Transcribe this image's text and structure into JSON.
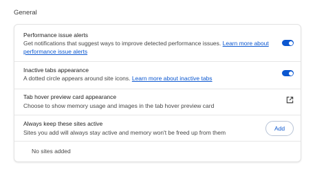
{
  "section": {
    "title": "General"
  },
  "performance_alerts": {
    "title": "Performance issue alerts",
    "desc_prefix": "Get notifications that suggest ways to improve detected performance issues. ",
    "link": "Learn more about performance issue alerts",
    "toggle_on": true
  },
  "inactive_tabs": {
    "title": "Inactive tabs appearance",
    "desc_prefix": "A dotted circle appears around site icons. ",
    "link": "Learn more about inactive tabs",
    "toggle_on": true
  },
  "hover_preview": {
    "title": "Tab hover preview card appearance",
    "desc": "Choose to show memory usage and images in the tab hover preview card",
    "icon": "open-in-new-icon"
  },
  "keep_active": {
    "title": "Always keep these sites active",
    "desc": "Sites you add will always stay active and memory won't be freed up from them",
    "add_label": "Add",
    "empty_text": "No sites added"
  },
  "colors": {
    "accent": "#0b57d0"
  }
}
